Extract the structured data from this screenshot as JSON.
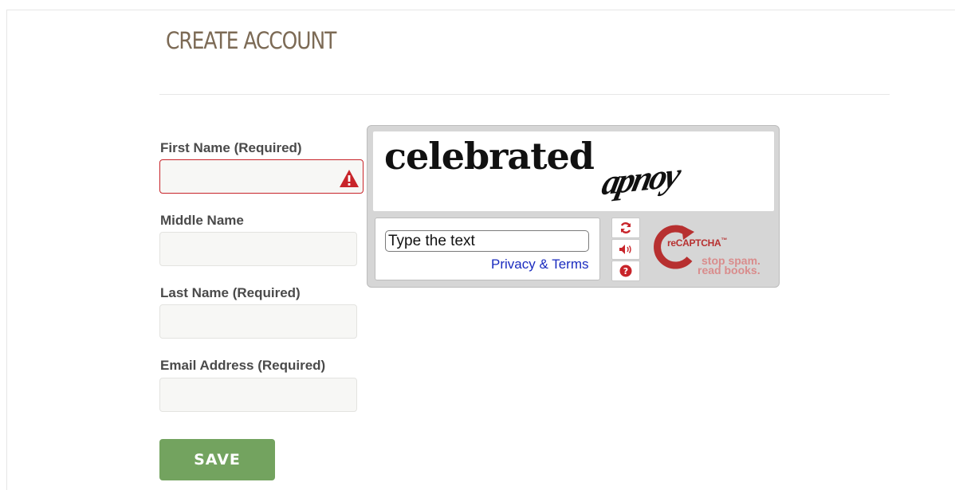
{
  "page": {
    "title": "CREATE ACCOUNT"
  },
  "form": {
    "first_name_label": "First Name (Required)",
    "middle_name_label": "Middle Name",
    "last_name_label": "Last Name (Required)",
    "email_label": "Email Address (Required)",
    "first_name_value": "",
    "middle_name_value": "",
    "last_name_value": "",
    "email_value": "",
    "first_name_state": "error",
    "save_label": "SAVE",
    "save_color": "#73a35f",
    "error_color": "#c8242a"
  },
  "captcha": {
    "challenge_word_1": "celebrated",
    "challenge_word_2": "apnoy",
    "input_placeholder": "Type the text",
    "privacy_link": "Privacy & Terms",
    "controls": [
      "refresh-icon",
      "audio-icon",
      "help-icon"
    ],
    "logo_text": "reCAPTCHA",
    "logo_tm": "™",
    "tagline_line1": "stop spam.",
    "tagline_line2": "read books."
  }
}
